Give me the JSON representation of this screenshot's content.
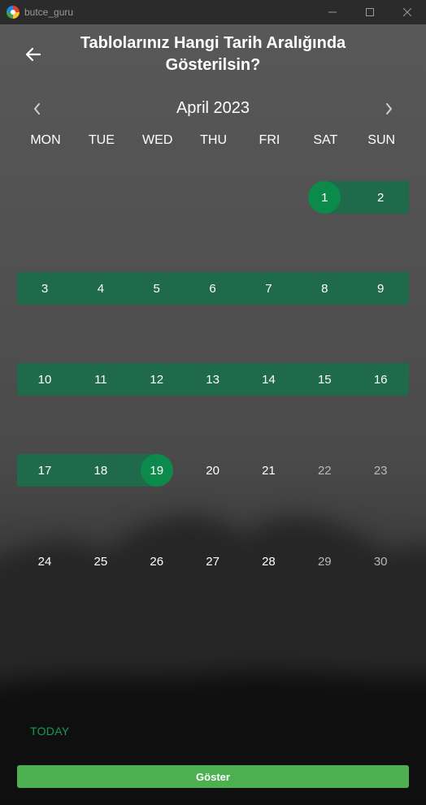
{
  "window": {
    "title": "butce_guru",
    "minimize_icon": "minimize-icon",
    "maximize_icon": "maximize-icon",
    "close_icon": "close-icon"
  },
  "header": {
    "title": "Tablolarınız Hangi Tarih Aralığında Gösterilsin?",
    "back_icon": "arrow-left-icon"
  },
  "calendar": {
    "month_label": "April 2023",
    "prev_icon": "chevron-left-icon",
    "next_icon": "chevron-right-icon",
    "weekdays": [
      "MON",
      "TUE",
      "WED",
      "THU",
      "FRI",
      "SAT",
      "SUN"
    ],
    "weeks": [
      [
        "",
        "",
        "",
        "",
        "",
        "1",
        "2"
      ],
      [
        "3",
        "4",
        "5",
        "6",
        "7",
        "8",
        "9"
      ],
      [
        "10",
        "11",
        "12",
        "13",
        "14",
        "15",
        "16"
      ],
      [
        "17",
        "18",
        "19",
        "20",
        "21",
        "22",
        "23"
      ],
      [
        "24",
        "25",
        "26",
        "27",
        "28",
        "29",
        "30"
      ]
    ],
    "range_start": "1",
    "range_end": "19",
    "range_color": "#1f6a4a",
    "selected_color": "#0c8a4c"
  },
  "actions": {
    "today_label": "TODAY",
    "show_label": "Göster",
    "show_color": "#4caf50"
  }
}
